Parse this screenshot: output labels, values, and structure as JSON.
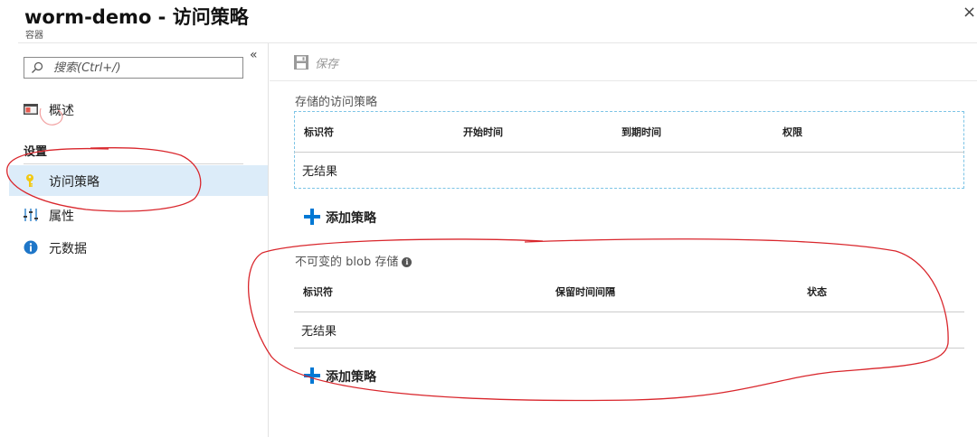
{
  "header": {
    "title": "worm-demo - 访问策略",
    "subtitle": "容器",
    "close_label": "×"
  },
  "sidebar": {
    "search_placeholder": "搜索(Ctrl+/)",
    "collapse_label": "«",
    "items": [
      {
        "label": "概述",
        "icon": "overview-icon"
      },
      {
        "label": "访问策略",
        "icon": "key-icon",
        "active": true
      },
      {
        "label": "属性",
        "icon": "properties-icon"
      },
      {
        "label": "元数据",
        "icon": "info-icon"
      }
    ],
    "section_label": "设置"
  },
  "toolbar": {
    "save_label": "保存"
  },
  "stored_policy": {
    "title": "存储的访问策略",
    "columns": [
      "标识符",
      "开始时间",
      "到期时间",
      "权限"
    ],
    "empty_text": "无结果",
    "add_label": "添加策略"
  },
  "immutable_storage": {
    "title": "不可变的 blob 存储",
    "info_glyph": "i",
    "columns": [
      "标识符",
      "保留时间间隔",
      "状态"
    ],
    "empty_text": "无结果",
    "add_label": "添加策略"
  },
  "colors": {
    "accent": "#0078d4",
    "active_bg": "#dcecf9",
    "annotation": "#d9262c",
    "key_icon": "#f2c811"
  }
}
